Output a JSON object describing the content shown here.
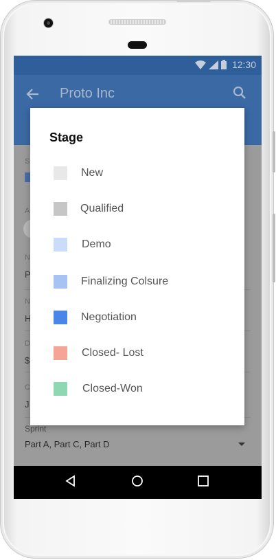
{
  "status_bar": {
    "time": "12:30"
  },
  "app_bar": {
    "title": "Proto Inc"
  },
  "form": {
    "labels": [
      "S",
      "A",
      "N",
      "N",
      "D",
      "C"
    ],
    "values": [
      "P",
      "H",
      "$",
      "J"
    ],
    "sprint_label": "Sprint",
    "sprint_value": "Part A, Part C, Part D"
  },
  "dialog": {
    "title": "Stage",
    "options": [
      {
        "label": "New",
        "color": "#e8e8e8"
      },
      {
        "label": "Qualified",
        "color": "#c6c6c6"
      },
      {
        "label": "Demo",
        "color": "#cbdcfb"
      },
      {
        "label": "Finalizing Colsure",
        "color": "#a6c3f3"
      },
      {
        "label": "Negotiation",
        "color": "#4a86e8"
      },
      {
        "label": "Closed- Lost",
        "color": "#f4a595"
      },
      {
        "label": "Closed-Won",
        "color": "#8fd6b3"
      }
    ]
  },
  "colors": {
    "app_bar": "#3b69a4",
    "status_bar": "#2f5f9a",
    "nav_bar": "#000000"
  }
}
